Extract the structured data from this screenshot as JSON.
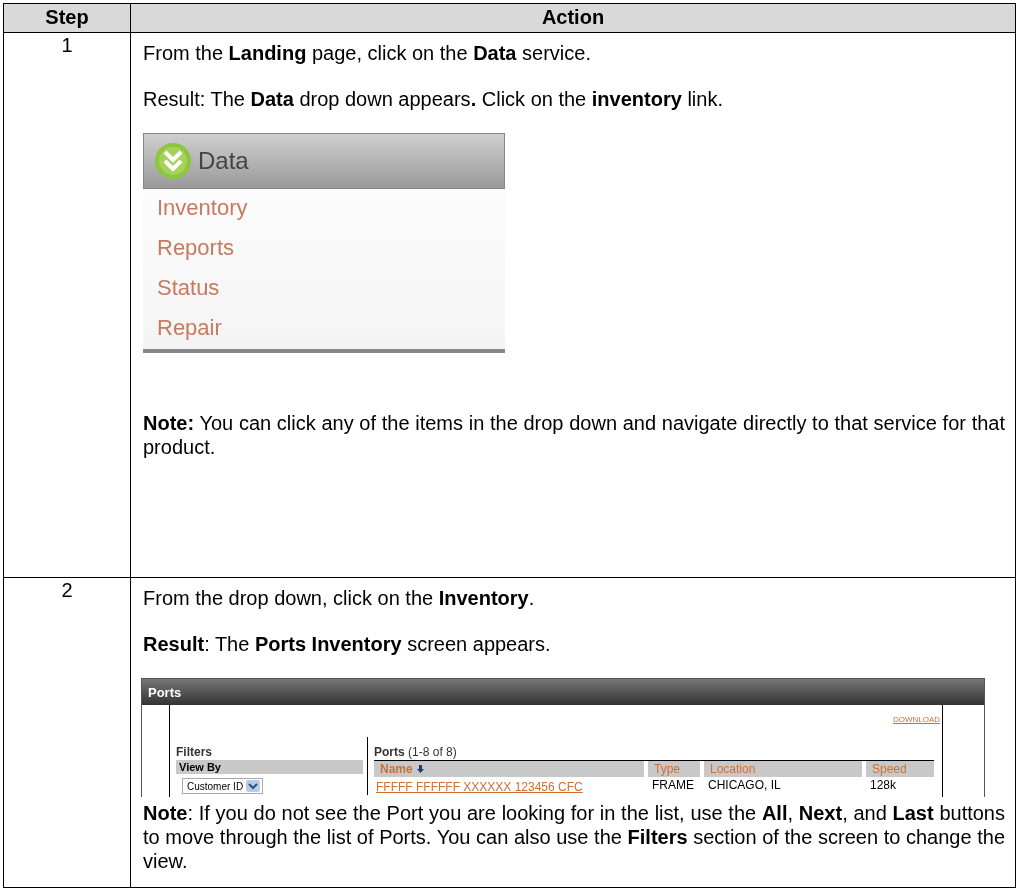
{
  "table": {
    "columns": [
      "Step",
      "Action"
    ],
    "rows": [
      {
        "step": "1",
        "blocks": [
          {
            "kind": "paragraph",
            "text": "From the **Landing** page, click on the **Data** service."
          },
          {
            "kind": "paragraph",
            "text": "Result:  The **Data** drop down appears**.**  Click on the **inventory** link."
          },
          {
            "kind": "menu_shot",
            "title": "Data",
            "items": [
              "Inventory",
              "Reports",
              "Status",
              "Repair"
            ]
          },
          {
            "kind": "paragraph",
            "text": "**Note:** You can click any of the items in the drop down and navigate directly to that service for that product."
          }
        ]
      },
      {
        "step": "2",
        "blocks": [
          {
            "kind": "paragraph",
            "text": "From the drop down, click on the **Inventory**."
          },
          {
            "kind": "paragraph",
            "text": "**Result**: The **Ports Inventory** screen appears."
          },
          {
            "kind": "ports_shot",
            "title": "Ports",
            "download": "DOWNLOAD",
            "filters_title": "Filters",
            "view_by": "View By",
            "select_value": "Customer ID",
            "list_title": "Ports",
            "count": "(1-8 of 8)",
            "columns": [
              "Name",
              "Type",
              "Location",
              "Speed"
            ],
            "row": [
              "FFFFF FFFFFF XXXXXX 123456 CFC",
              "FRAME",
              "CHICAGO, IL",
              "128k"
            ]
          },
          {
            "kind": "paragraph",
            "text": "**Note**:  If you do not see the Port you are looking for in the list, use the **All**, **Next**, and **Last** buttons to move through the list of Ports.  You can also use the **Filters** section of the screen to change the view."
          }
        ]
      }
    ]
  }
}
